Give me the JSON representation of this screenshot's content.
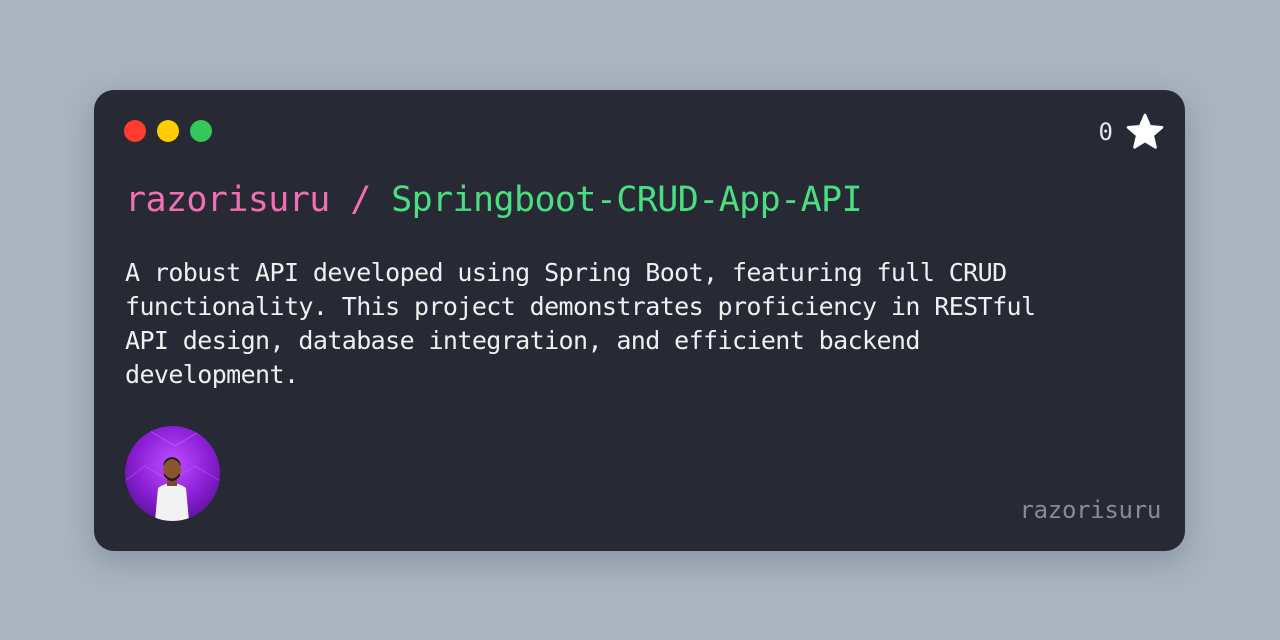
{
  "window": {
    "controls": [
      {
        "name": "close",
        "color": "#ff3b30"
      },
      {
        "name": "minimize",
        "color": "#ffcc00"
      },
      {
        "name": "zoom",
        "color": "#34c759"
      }
    ]
  },
  "stars": {
    "count": "0",
    "icon": "star-icon"
  },
  "repo": {
    "owner": "razorisuru",
    "separator": " / ",
    "name": "Springboot-CRUD-App-API",
    "owner_color": "#f36fb5",
    "name_color": "#4ade80",
    "separator_color": "#f36fb5"
  },
  "description": "A robust API developed using Spring Boot, featuring full CRUD functionality. This project demonstrates proficiency in RESTful API design, database integration, and efficient backend development.",
  "footer": {
    "avatar_icon": "user-avatar-photo",
    "username": "razorisuru"
  }
}
